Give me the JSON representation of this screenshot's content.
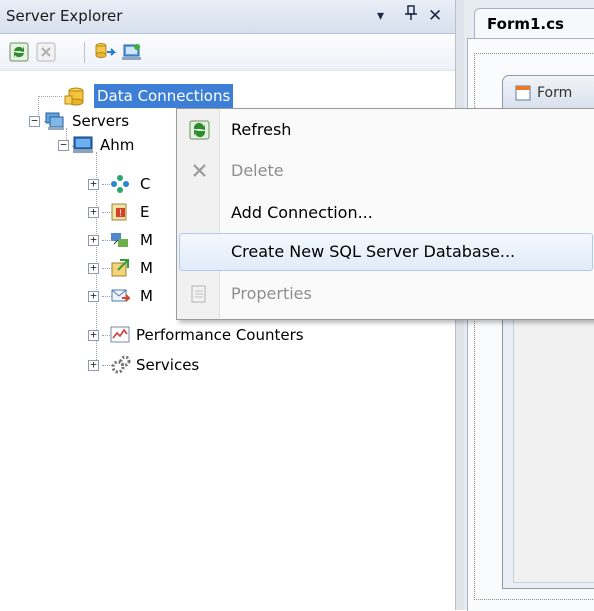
{
  "explorer": {
    "title": "Server Explorer",
    "pin_glyph": "▾",
    "autohide_glyph": "ᵖ",
    "close_glyph": "✕",
    "toolbar": [
      {
        "name": "refresh-icon"
      },
      {
        "name": "stop-refresh-icon"
      },
      {
        "name": "connect-to-database-icon"
      },
      {
        "name": "connect-to-server-icon"
      }
    ],
    "tree": {
      "data_connections": "Data Connections",
      "servers": "Servers",
      "machine": "Ahm",
      "children": [
        "C",
        "E",
        "M",
        "M",
        "M",
        "Performance Counters",
        "Services"
      ]
    }
  },
  "designer": {
    "tab_label": "Form1.cs",
    "form_title": "Form"
  },
  "context_menu": {
    "items": [
      {
        "label": "Refresh",
        "icon": "refresh-icon",
        "enabled": true
      },
      {
        "label": "Delete",
        "icon": "delete-icon",
        "enabled": false
      },
      {
        "label": "Add Connection...",
        "icon": "",
        "enabled": true
      },
      {
        "label": "Create New SQL Server Database...",
        "icon": "",
        "enabled": true,
        "highlighted": true
      },
      {
        "label": "Properties",
        "icon": "properties-icon",
        "enabled": false
      }
    ]
  },
  "colors": {
    "selection": "#3d7fd6",
    "menu_highlight_border": "#aecaf0",
    "refresh_green": "#2e8b2e"
  }
}
